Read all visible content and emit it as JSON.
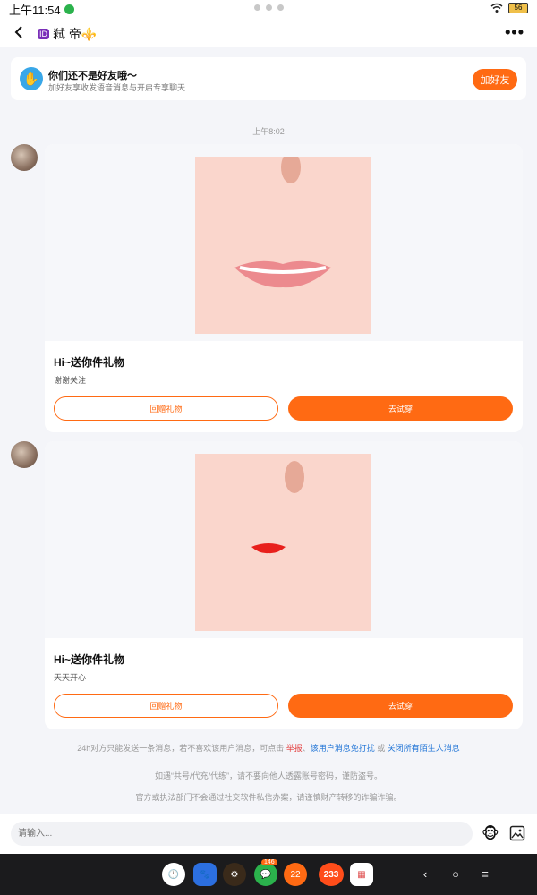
{
  "status_bar": {
    "time": "上午11:54",
    "battery": "56"
  },
  "header": {
    "badge": "ID",
    "title": "弒 帝⚜️"
  },
  "banner": {
    "title": "你们还不是好友哦～",
    "subtitle": "加好友享收发语音消息与开启专享聊天",
    "button": "加好友"
  },
  "timestamp": "上午8:02",
  "messages": [
    {
      "title": "Hi~送你件礼物",
      "subtitle": "谢谢关注",
      "btn_return": "回赠礼物",
      "btn_try": "去试穿"
    },
    {
      "title": "Hi~送你件礼物",
      "subtitle": "天天开心",
      "btn_return": "回赠礼物",
      "btn_try": "去试穿"
    }
  ],
  "notice": {
    "line1_a": "24h对方只能发送一条消息，若不喜欢该用户消息，可点击 ",
    "line1_report": "举报",
    "line1_sep": "、",
    "line1_block": "该用户消息免打扰",
    "line1_or": " 或 ",
    "line1_close": "关闭所有陌生人消息",
    "line2": "如遇“共号/代充/代练”，请不要向他人透露账号密码，谨防盗号。",
    "line3": "官方或执法部门不会通过社交软件私信办案，请谨慎财产转移的诈骗诈骗。"
  },
  "input": {
    "placeholder": "请输入..."
  },
  "dock": {
    "badge_wechat": "146",
    "app_22": "22",
    "app_233": "233"
  },
  "colors": {
    "accent": "#ff6a13",
    "link_red": "#e33b3b",
    "link_blue": "#1f74d6"
  }
}
